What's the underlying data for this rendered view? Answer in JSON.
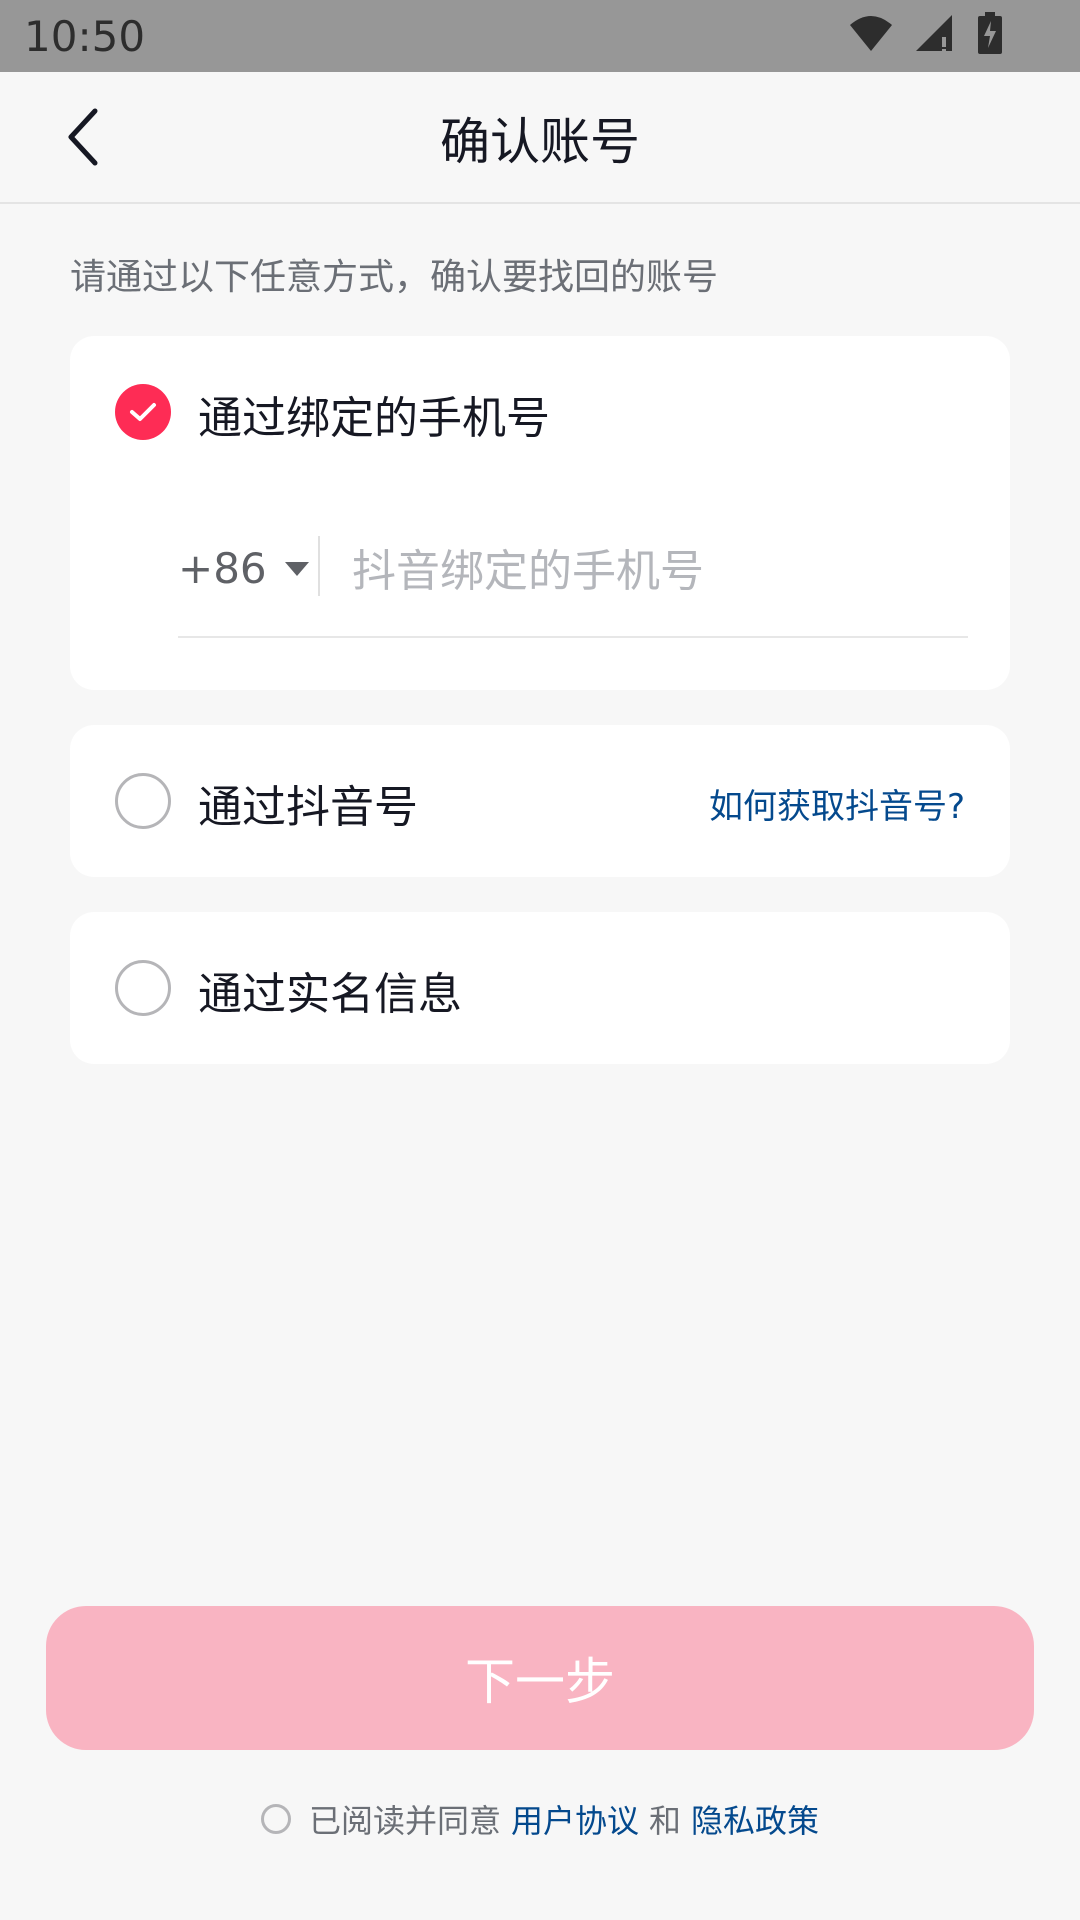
{
  "status_bar": {
    "time": "10:50",
    "icons": [
      "wifi-icon",
      "signal-icon",
      "battery-charging-icon"
    ]
  },
  "header": {
    "title": "确认账号",
    "back_icon": "chevron-left-icon"
  },
  "hint": "请通过以下任意方式，确认要找回的账号",
  "options": [
    {
      "label": "通过绑定的手机号",
      "selected": true,
      "country_code": "+86",
      "phone_placeholder": "抖音绑定的手机号",
      "phone_value": ""
    },
    {
      "label": "通过抖音号",
      "selected": false,
      "help_link": "如何获取抖音号?"
    },
    {
      "label": "通过实名信息",
      "selected": false
    }
  ],
  "next_button": {
    "label": "下一步"
  },
  "agreement": {
    "checked": false,
    "prefix": "已阅读并同意",
    "user_agreement": "用户协议",
    "and": "和",
    "privacy_policy": "隐私政策"
  },
  "colors": {
    "accent": "#fe2c55",
    "link": "#04498d",
    "button_disabled": "#f9b4c2"
  }
}
